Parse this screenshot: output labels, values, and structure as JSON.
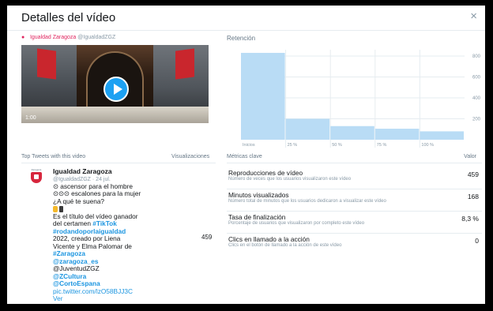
{
  "dialog": {
    "title": "Detalles del vídeo",
    "close": "×"
  },
  "author": {
    "name": "Igualdad Zaragoza",
    "handle": "@IgualdadZGZ"
  },
  "video": {
    "duration": "1:00"
  },
  "retention": {
    "title": "Retención"
  },
  "chart_data": {
    "type": "bar",
    "categories": [
      "Inicios",
      "25 %",
      "50 %",
      "75 %",
      "100 %"
    ],
    "values": [
      830,
      200,
      130,
      105,
      80
    ],
    "ylim": [
      0,
      860
    ],
    "yticks": [
      200,
      400,
      600,
      800
    ],
    "ytick_labels": [
      "200",
      "400",
      "600",
      "800"
    ],
    "grid": true,
    "bar_color": "#b9dcf5",
    "title": "",
    "xlabel": "",
    "ylabel": ""
  },
  "tweets": {
    "header_left": "Top Tweets with this video",
    "header_right": "Visualizaciones",
    "item": {
      "avatar_label": "Zaragoza",
      "name": "Igualdad Zaragoza",
      "meta": "@IgualdadZGZ · 24 jul.",
      "line1": "⊙ ascensor para el hombre",
      "line2": "⊙⊙⊙ escalones para la mujer",
      "line3": "¿A qué te suena?",
      "line4": "Es el título del vídeo ganador",
      "line5": "del certamen",
      "tag1": "#TikTok",
      "tag2": "#rodandoporlaigualdad",
      "line6": "2022, creado por Liena",
      "line7": "Vicente y Elma Palomar de",
      "tag3": "#Zaragoza",
      "tag4": "@zaragoza_es",
      "line8": "@JuventudZGZ",
      "tag5": "@ZCultura",
      "tag6": "@CortoEspana",
      "link": "pic.twitter.com/lzO58BJJ3C",
      "more": "Ver",
      "views": "459"
    }
  },
  "metrics": {
    "header_left": "Métricas clave",
    "header_right": "Valor",
    "items": [
      {
        "name": "Reproducciones de vídeo",
        "desc": "Número de veces que los usuarios visualizaron este vídeo",
        "value": "459"
      },
      {
        "name": "Minutos visualizados",
        "desc": "Número total de minutos que los usuarios dedicaron a visualizar este vídeo",
        "value": "168"
      },
      {
        "name": "Tasa de finalización",
        "desc": "Porcentaje de usuarios que visualizaron por completo este vídeo",
        "value": "8,3 %"
      },
      {
        "name": "Clics en llamado a la acción",
        "desc": "Clics en el botón de llamado a la acción de este vídeo",
        "value": "0"
      }
    ]
  }
}
